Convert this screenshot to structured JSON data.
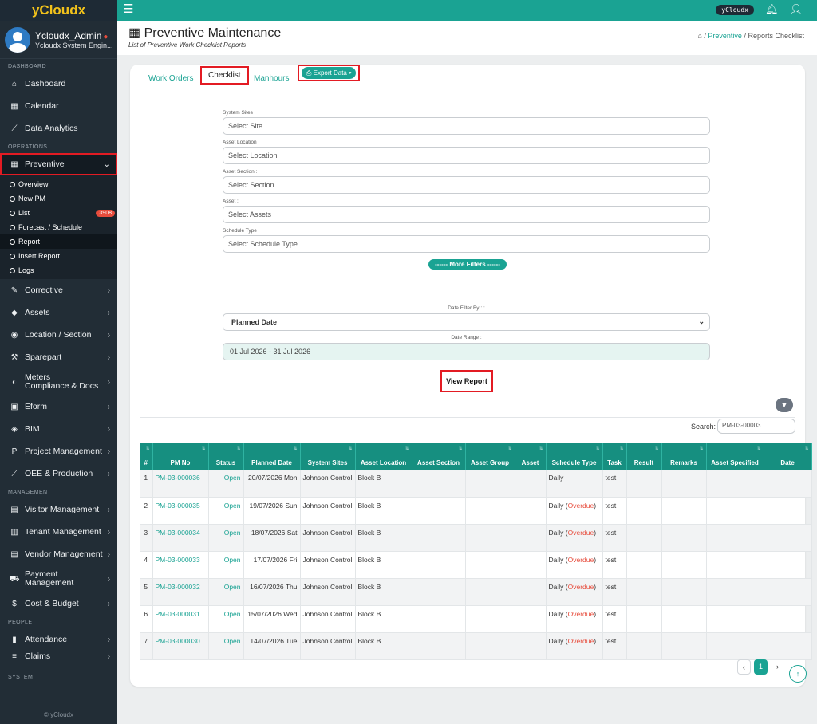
{
  "brand": "yCloudx",
  "topbar": {
    "user_pill": "yCloudx",
    "bell_icon": "bell-icon",
    "user_icon": "user-icon",
    "menu_icon": "hamburger-icon"
  },
  "profile": {
    "name": "Ycloudx_Admin",
    "role": "Ycloudx System Engin..."
  },
  "sidebar": {
    "sections": {
      "dashboard": "DASHBOARD",
      "operations": "OPERATIONS",
      "management": "MANAGEMENT",
      "people": "PEOPLE",
      "system": "SYSTEM"
    },
    "dashboard": "Dashboard",
    "calendar": "Calendar",
    "analytics": "Data Analytics",
    "preventive": "Preventive",
    "sub": {
      "overview": "Overview",
      "newpm": "New PM",
      "list": "List",
      "list_badge": "3908",
      "forecast": "Forecast / Schedule",
      "report": "Report",
      "insert": "Insert Report",
      "logs": "Logs"
    },
    "corrective": "Corrective",
    "assets": "Assets",
    "location": "Location / Section",
    "sparepart": "Sparepart",
    "meters": "Meters",
    "compliance": "Compliance & Docs",
    "eform": "Eform",
    "bim": "BIM",
    "project": "Project Management",
    "oee": "OEE & Production",
    "visitor": "Visitor Management",
    "tenant": "Tenant Management",
    "vendor": "Vendor Management",
    "payment1": "Payment",
    "payment2": "Management",
    "cost": "Cost & Budget",
    "attendance": "Attendance",
    "claims": "Claims",
    "footer": "© yCloudx"
  },
  "page": {
    "title": "Preventive Maintenance",
    "subtitle": "List of Preventive Work Checklist Reports"
  },
  "breadcrumb": {
    "sep1": "/",
    "preventive": "Preventive",
    "sep2": "/",
    "current": "Reports Checklist"
  },
  "tabs": {
    "work_orders": "Work Orders",
    "checklist": "Checklist",
    "manhours": "Manhours",
    "export": "Export Data"
  },
  "filters": {
    "site_label": "System Sites :",
    "site_ph": "Select Site",
    "location_label": "Asset Location :",
    "location_ph": "Select Location",
    "section_label": "Asset Section :",
    "section_ph": "Select Section",
    "asset_label": "Asset :",
    "asset_ph": "Select Assets",
    "schedule_label": "Schedule Type :",
    "schedule_ph": "Select Schedule Type",
    "more": "------ More Filters ------",
    "date_filter_label": "Date Filter By : :",
    "date_filter_value": "Planned Date",
    "date_range_label": "Date Range :",
    "date_range_value": "01 Jul 2026 - 31 Jul 2026",
    "view_report": "View Report"
  },
  "search": {
    "label": "Search:",
    "value": "PM-03-00003"
  },
  "table": {
    "headers": [
      "#",
      "PM No",
      "Status",
      "Planned Date",
      "System Sites",
      "Asset Location",
      "Asset Section",
      "Asset Group",
      "Asset",
      "Schedule Type",
      "Task",
      "Result",
      "Remarks",
      "Asset Specified",
      "Date"
    ],
    "rows": [
      {
        "n": "1",
        "pm": "PM-03-000036",
        "status": "Open",
        "date": "20/07/2026 Mon",
        "site": "Johnson Control",
        "loc": "Block B",
        "sched": "Daily",
        "overdue": "",
        "task": "test"
      },
      {
        "n": "2",
        "pm": "PM-03-000035",
        "status": "Open",
        "date": "19/07/2026 Sun",
        "site": "Johnson Control",
        "loc": "Block B",
        "sched": "Daily",
        "overdue": "Overdue",
        "task": "test"
      },
      {
        "n": "3",
        "pm": "PM-03-000034",
        "status": "Open",
        "date": "18/07/2026 Sat",
        "site": "Johnson Control",
        "loc": "Block B",
        "sched": "Daily",
        "overdue": "Overdue",
        "task": "test"
      },
      {
        "n": "4",
        "pm": "PM-03-000033",
        "status": "Open",
        "date": "17/07/2026 Fri",
        "site": "Johnson Control",
        "loc": "Block B",
        "sched": "Daily",
        "overdue": "Overdue",
        "task": "test"
      },
      {
        "n": "5",
        "pm": "PM-03-000032",
        "status": "Open",
        "date": "16/07/2026 Thu",
        "site": "Johnson Control",
        "loc": "Block B",
        "sched": "Daily",
        "overdue": "Overdue",
        "task": "test"
      },
      {
        "n": "6",
        "pm": "PM-03-000031",
        "status": "Open",
        "date": "15/07/2026 Wed",
        "site": "Johnson Control",
        "loc": "Block B",
        "sched": "Daily",
        "overdue": "Overdue",
        "task": "test"
      },
      {
        "n": "7",
        "pm": "PM-03-000030",
        "status": "Open",
        "date": "14/07/2026 Tue",
        "site": "Johnson Control",
        "loc": "Block B",
        "sched": "Daily",
        "overdue": "Overdue",
        "task": "test"
      }
    ]
  },
  "pagination": {
    "prev": "‹",
    "page": "1",
    "next": "›"
  },
  "colors": {
    "accent": "#1aa393",
    "sidebar": "#222d36",
    "highlight": "#e31b23",
    "overdue": "#e74c3c"
  }
}
